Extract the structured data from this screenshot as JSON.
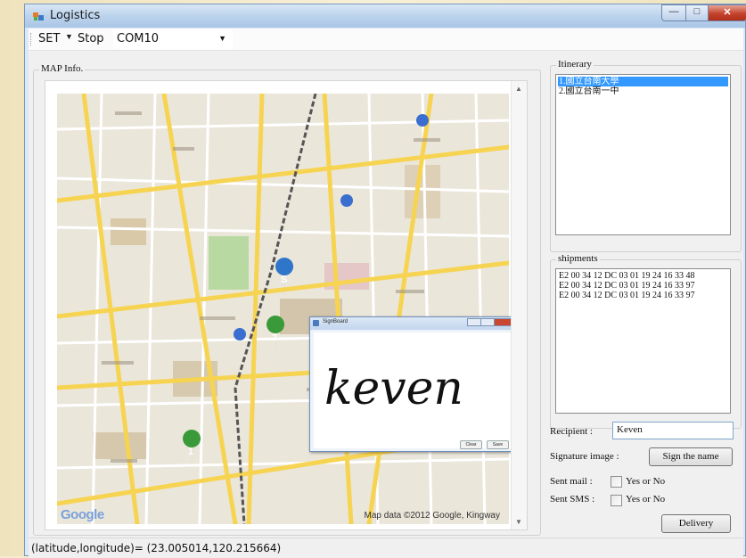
{
  "window": {
    "title": "Logistics"
  },
  "toolbar": {
    "set_label": "SET",
    "stop_label": "Stop",
    "port_value": "COM10"
  },
  "map": {
    "group_label": "MAP Info.",
    "credit": "Map data ©2012 Google, Kingway",
    "logo": "Google",
    "markers": [
      {
        "label": "S"
      },
      {
        "label": "2"
      },
      {
        "label": "1"
      }
    ]
  },
  "signboard": {
    "title": "SignBoard",
    "signature_text": "keven",
    "clear_label": "Clear",
    "save_label": "Save"
  },
  "itinerary": {
    "group_label": "Itinerary",
    "items": [
      "1.國立台南大學",
      "2.國立台南一中"
    ],
    "selected_index": 0
  },
  "shipments": {
    "group_label": "shipments",
    "items": [
      "E2 00 34 12 DC 03 01 19 24 16 33 48",
      "E2 00 34 12 DC 03 01 19 24 16 33 97",
      "E2 00 34 12 DC 03 01 19 24 16 33 97"
    ]
  },
  "form": {
    "recipient_label": "Recipient :",
    "recipient_value": "Keven",
    "signature_label": "Signature image :",
    "sign_button": "Sign the name",
    "sent_mail_label": "Sent mail :",
    "sent_sms_label": "Sent SMS :",
    "yes_or_no": "Yes or No",
    "delivery_button": "Delivery"
  },
  "status": {
    "text": "(latitude,longitude)=  (23.005014,120.215664)"
  },
  "colors": {
    "selection": "#3399ff",
    "road": "#f6d452",
    "park": "#b9d9a3"
  }
}
